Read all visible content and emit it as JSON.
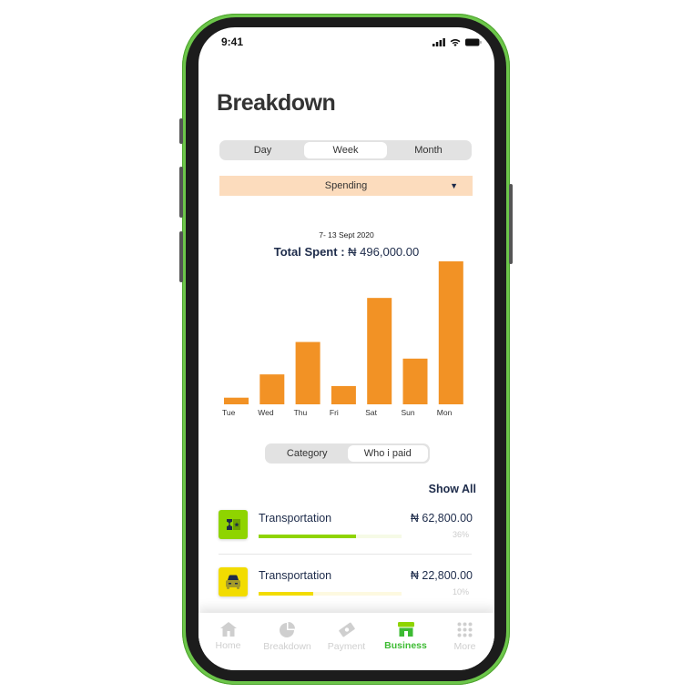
{
  "status_bar": {
    "time": "9:41"
  },
  "header": {
    "title": "Breakdown"
  },
  "period_tabs": [
    {
      "label": "Day",
      "active": false
    },
    {
      "label": "Week",
      "active": true
    },
    {
      "label": "Month",
      "active": false
    }
  ],
  "type_dropdown": {
    "selected": "Spending",
    "caret": "▼"
  },
  "summary": {
    "date_range": "7- 13 Sept 2020",
    "total_label": "Total Spent :",
    "total_value": "₦ 496,000.00"
  },
  "chart_data": {
    "type": "bar",
    "title": "Total Spent : ₦ 496,000.00",
    "subtitle": "7- 13 Sept 2020",
    "categories": [
      "Tue",
      "Wed",
      "Thu",
      "Fri",
      "Sat",
      "Sun",
      "Mon"
    ],
    "values": [
      8000,
      36000,
      75000,
      22000,
      128000,
      55000,
      172000
    ],
    "xlabel": "",
    "ylabel": "",
    "ylim": [
      0,
      172000
    ],
    "grid": false,
    "bar_color": "#f29225"
  },
  "view_tabs": [
    {
      "label": "Category",
      "active": false
    },
    {
      "label": "Who i paid",
      "active": true
    }
  ],
  "list": {
    "show_all_label": "Show All",
    "items": [
      {
        "icon": "ticket-icon",
        "name": "Transportation",
        "amount": "₦ 62,800.00",
        "percent_label": "36%",
        "percent": 0.68,
        "icon_bg": "#8fd400",
        "bar_color": "#8fd400",
        "track_color": "#f6fae6"
      },
      {
        "icon": "car-icon",
        "name": "Transportation",
        "amount": "₦ 22,800.00",
        "percent_label": "10%",
        "percent": 0.38,
        "icon_bg": "#f2dc00",
        "bar_color": "#f2dc00",
        "track_color": "#fdf9e0"
      }
    ]
  },
  "nav": [
    {
      "label": "Home",
      "icon": "home-icon",
      "active": false
    },
    {
      "label": "Breakdown",
      "icon": "pie-chart-icon",
      "active": false
    },
    {
      "label": "Payment",
      "icon": "payment-icon",
      "active": false
    },
    {
      "label": "Business",
      "icon": "store-icon",
      "active": true
    },
    {
      "label": "More",
      "icon": "grid-icon",
      "active": false
    }
  ],
  "colors": {
    "accent_green": "#3dbb33",
    "phone_frame": "#6cc64a",
    "bar_orange": "#f29225",
    "dropdown_bg": "#fcdcbd",
    "navy_text": "#1d2b4a"
  }
}
